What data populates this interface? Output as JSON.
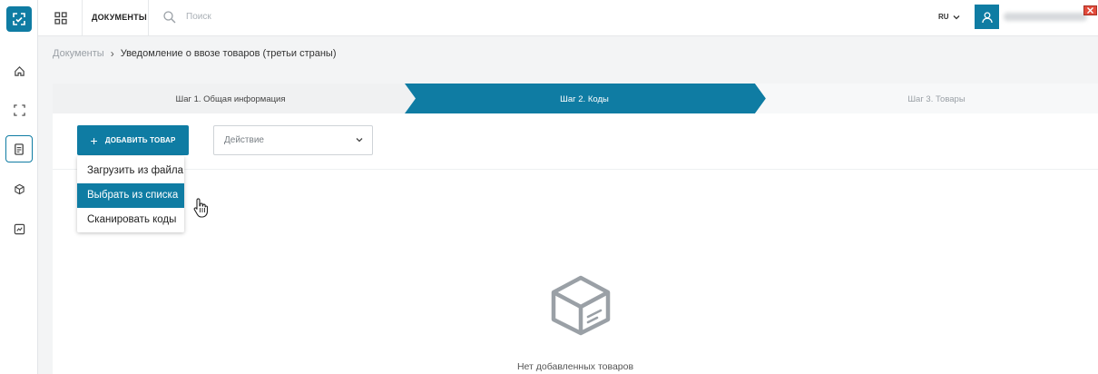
{
  "topbar": {
    "section_label": "ДОКУМЕНТЫ",
    "search_placeholder": "Поиск",
    "language": "RU"
  },
  "breadcrumb": {
    "root": "Документы",
    "current": "Уведомление о ввозе товаров (третьи страны)"
  },
  "steps": [
    {
      "label": "Шаг 1. Общая информация",
      "state": "done"
    },
    {
      "label": "Шаг 2. Коды",
      "state": "active"
    },
    {
      "label": "Шаг 3. Товары",
      "state": "pending"
    }
  ],
  "toolbar": {
    "add_label": "ДОБАВИТЬ ТОВАР",
    "action_placeholder": "Действие"
  },
  "add_menu": [
    {
      "label": "Загрузить из файла"
    },
    {
      "label": "Выбрать из списка"
    },
    {
      "label": "Сканировать коды"
    }
  ],
  "empty_state": {
    "text": "Нет добавленных товаров"
  },
  "colors": {
    "accent": "#0f7ca3",
    "step_done_bg": "#f0f1f2",
    "step_pending_bg": "#f7f8f9"
  }
}
